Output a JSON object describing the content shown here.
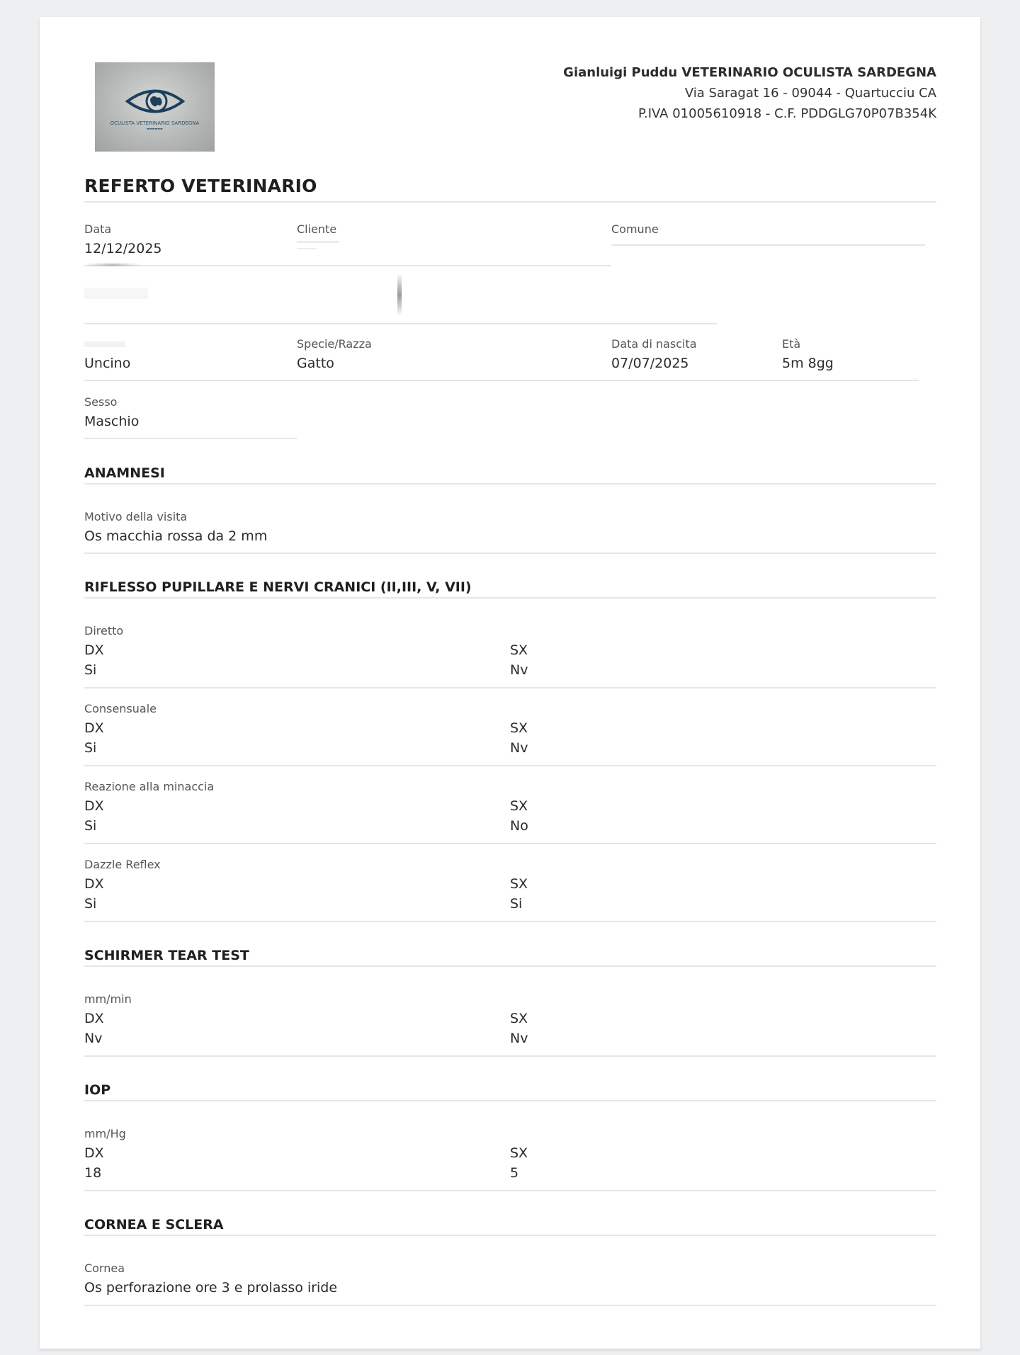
{
  "header": {
    "clinic_name": "Gianluigi Puddu VETERINARIO OCULISTA SARDEGNA",
    "address": "Via Saragat 16 - 09044 - Quartucciu CA",
    "tax_ids": "P.IVA 01005610918 - C.F. PDDGLG70P07B354K",
    "logo_text": "OCULISTA VETERINARIO SARDEGNA"
  },
  "title": "REFERTO VETERINARIO",
  "info": {
    "data_label": "Data",
    "data_value": "12/12/2025",
    "cliente_label": "Cliente",
    "comune_label": "Comune",
    "nome_value": "Uncino",
    "specie_label": "Specie/Razza",
    "specie_value": "Gatto",
    "nascita_label": "Data di nascita",
    "nascita_value": "07/07/2025",
    "eta_label": "Età",
    "eta_value": "5m 8gg",
    "sesso_label": "Sesso",
    "sesso_value": "Maschio"
  },
  "anamnesi": {
    "title": "ANAMNESI",
    "motivo_label": "Motivo della visita",
    "motivo_value": "Os macchia rossa da 2 mm"
  },
  "riflesso": {
    "title": "RIFLESSO PUPILLARE E NERVI CRANICI (II,III, V, VII)",
    "rows": [
      {
        "label": "Diretto",
        "dx_label": "DX",
        "sx_label": "SX",
        "dx": "Si",
        "sx": "Nv"
      },
      {
        "label": "Consensuale",
        "dx_label": "DX",
        "sx_label": "SX",
        "dx": "Si",
        "sx": "Nv"
      },
      {
        "label": "Reazione alla minaccia",
        "dx_label": "DX",
        "sx_label": "SX",
        "dx": "Si",
        "sx": "No"
      },
      {
        "label": "Dazzle Reflex",
        "dx_label": "DX",
        "sx_label": "SX",
        "dx": "Si",
        "sx": "Si"
      }
    ]
  },
  "schirmer": {
    "title": "SCHIRMER TEAR TEST",
    "unit": "mm/min",
    "dx_label": "DX",
    "sx_label": "SX",
    "dx": "Nv",
    "sx": "Nv"
  },
  "iop": {
    "title": "IOP",
    "unit": "mm/Hg",
    "dx_label": "DX",
    "sx_label": "SX",
    "dx": "18",
    "sx": "5"
  },
  "cornea": {
    "title": "CORNEA E SCLERA",
    "label": "Cornea",
    "value": "Os perforazione ore 3 e prolasso iride"
  }
}
